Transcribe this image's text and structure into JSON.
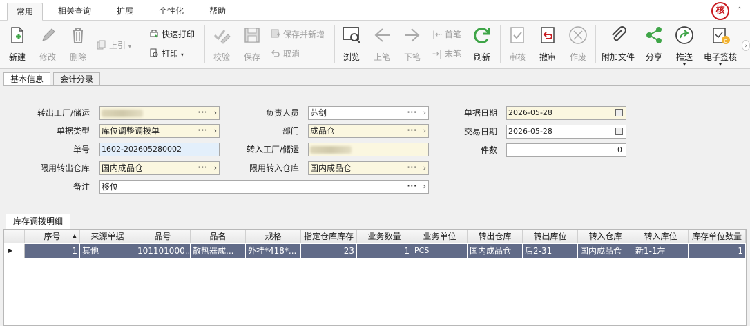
{
  "menu": {
    "tabs": [
      "常用",
      "相关查询",
      "扩展",
      "个性化",
      "帮助"
    ],
    "logo_text": "核",
    "collapse_symbol": "⌃"
  },
  "toolbar": {
    "new": "新建",
    "edit": "修改",
    "delete": "删除",
    "prev_ref": "上引",
    "quick_print": "快速打印",
    "print": "打印",
    "check": "校验",
    "save": "保存",
    "save_new": "保存并新增",
    "cancel": "取消",
    "browse": "浏览",
    "prev": "上笔",
    "next": "下笔",
    "first": "首笔",
    "last": "末笔",
    "refresh": "刷新",
    "audit": "审核",
    "unaudit": "撤审",
    "void": "作废",
    "attach": "附加文件",
    "share": "分享",
    "push": "推送",
    "esign": "电子签核"
  },
  "form_tabs": [
    "基本信息",
    "会计分录"
  ],
  "form": {
    "out_factory_label": "转出工厂/储运",
    "doc_type_label": "单据类型",
    "doc_type": "库位调整调拨单",
    "doc_no_label": "单号",
    "doc_no": "1602-202605280002",
    "limit_out_wh_label": "限用转出仓库",
    "limit_out_wh": "国内成品仓",
    "remark_label": "备注",
    "remark": "移位",
    "owner_label": "负责人员",
    "owner": "苏剑",
    "dept_label": "部门",
    "dept": "成品仓",
    "in_factory_label": "转入工厂/储运",
    "limit_in_wh_label": "限用转入仓库",
    "limit_in_wh": "国内成品仓",
    "doc_date_label": "单据日期",
    "doc_date": "2026-05-28",
    "trade_date_label": "交易日期",
    "trade_date": "2026-05-28",
    "count_label": "件数",
    "count": "0",
    "dots": "···",
    "chev": "›"
  },
  "detail": {
    "tab": "库存调拨明细",
    "columns": [
      "序号",
      "来源单据",
      "品号",
      "品名",
      "规格",
      "指定仓库库存",
      "业务数量",
      "业务单位",
      "转出仓库",
      "转出库位",
      "转入仓库",
      "转入库位",
      "库存单位数量"
    ],
    "sort_marker": "▲",
    "row_marker": "▶",
    "rows": [
      [
        "1",
        "其他",
        "101101000...",
        "散热器成...",
        "外挂*418*...",
        "23",
        "1",
        "PCS",
        "国内成品仓",
        "后2-31",
        "国内成品仓",
        "新1-1左",
        "1"
      ]
    ]
  },
  "colors": {
    "selected_row": "#616b88",
    "required_field": "#fbf7e0",
    "logo_red": "#c8191f",
    "green_icon": "#3fa548"
  }
}
